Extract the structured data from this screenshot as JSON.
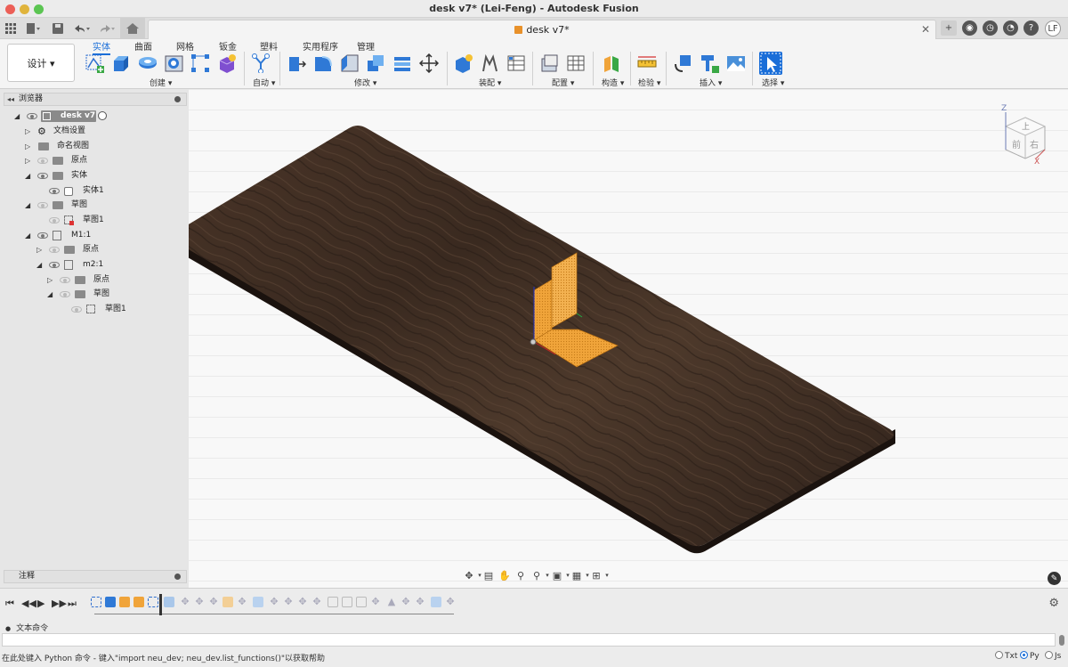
{
  "window": {
    "title": "desk v7* (Lei-Feng) - Autodesk Fusion"
  },
  "colors": {
    "accent": "#1a6ed8",
    "wood": "#3b2a21",
    "body_orange": "#f0a43a"
  },
  "doc_tab": {
    "label": "desk v7*",
    "icon": "document-icon"
  },
  "user": {
    "initials": "LF"
  },
  "workspace": {
    "label": "设计 ▾"
  },
  "ribbon": {
    "tabs": [
      "实体",
      "曲面",
      "网格",
      "钣金",
      "塑料",
      "实用程序",
      "管理"
    ],
    "groups": [
      "创建 ▾",
      "自动 ▾",
      "修改 ▾",
      "装配 ▾",
      "配置 ▾",
      "构造 ▾",
      "检验 ▾",
      "插入 ▾",
      "选择 ▾"
    ]
  },
  "browser": {
    "title": "浏览器",
    "items": [
      {
        "label": "desk v7",
        "icon": "component-icon"
      },
      {
        "label": "文档设置",
        "icon": "gear-icon"
      },
      {
        "label": "命名视图",
        "icon": "folder-icon"
      },
      {
        "label": "原点",
        "icon": "folder-icon"
      },
      {
        "label": "实体",
        "icon": "folder-icon"
      },
      {
        "label": "实体1",
        "icon": "body-icon"
      },
      {
        "label": "草图",
        "icon": "folder-icon"
      },
      {
        "label": "草图1",
        "icon": "sketch-icon"
      },
      {
        "label": "M1:1",
        "icon": "component-icon"
      },
      {
        "label": "原点",
        "icon": "folder-icon"
      },
      {
        "label": "m2:1",
        "icon": "component-icon"
      },
      {
        "label": "原点",
        "icon": "folder-icon"
      },
      {
        "label": "草图",
        "icon": "folder-icon"
      },
      {
        "label": "草图1",
        "icon": "sketch-icon"
      }
    ]
  },
  "notes": {
    "title": "注释"
  },
  "viewcube": {
    "top_label": "上",
    "front_label": "前",
    "right_label": "右",
    "z_label": "Z",
    "x_label": "X"
  },
  "command": {
    "label": "文本命令",
    "status": "在此处键入 Python 命令 - 键入\"import neu_dev; neu_dev.list_functions()\"以获取帮助",
    "langs": [
      "Txt",
      "Py",
      "Js"
    ],
    "selected_lang": "Py"
  }
}
